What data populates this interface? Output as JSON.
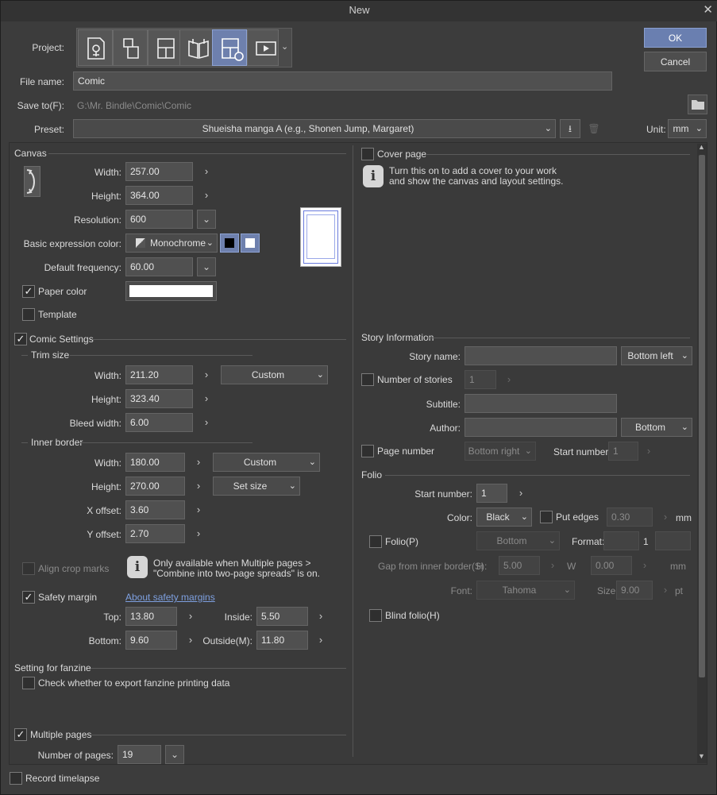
{
  "window": {
    "title": "New",
    "close_icon": "close-icon"
  },
  "buttons": {
    "ok": "OK",
    "cancel": "Cancel"
  },
  "project": {
    "label": "Project:",
    "items": [
      "illustration-icon",
      "webtoon-icon",
      "comic-icon",
      "book-icon",
      "comic-settings-icon",
      "animation-icon"
    ],
    "active_index": 4
  },
  "file_name": {
    "label": "File name:",
    "value": "Comic"
  },
  "save_to": {
    "label": "Save to(F):",
    "value": "G:\\Mr. Bindle\\Comic\\Comic"
  },
  "preset": {
    "label": "Preset:",
    "value": "Shueisha manga A (e.g., Shonen Jump, Margaret)",
    "unit_label": "Unit:",
    "unit_value": "mm"
  },
  "canvas": {
    "title": "Canvas",
    "width_label": "Width:",
    "width": "257.00",
    "height_label": "Height:",
    "height": "364.00",
    "resolution_label": "Resolution:",
    "resolution": "600",
    "color_label": "Basic expression color:",
    "color_value": "Monochrome",
    "freq_label": "Default frequency:",
    "freq": "60.00",
    "paper_color_label": "Paper color",
    "template_label": "Template"
  },
  "comic": {
    "title": "Comic Settings",
    "trim_title": "Trim size",
    "trim_width": "211.20",
    "trim_height": "323.40",
    "trim_preset": "Custom",
    "bleed_label": "Bleed width:",
    "bleed": "6.00",
    "inner_title": "Inner border",
    "inner_width": "180.00",
    "inner_height": "270.00",
    "inner_preset": "Custom",
    "inner_size": "Set size",
    "xoff_label": "X offset:",
    "xoff": "3.60",
    "yoff_label": "Y offset:",
    "yoff": "2.70",
    "width_label": "Width:",
    "height_label": "Height:",
    "align_label": "Align crop marks",
    "align_note_1": "Only available when Multiple pages >",
    "align_note_2": "\"Combine into two-page spreads\" is on.",
    "safety_label": "Safety margin",
    "safety_link": "About safety margins",
    "top_label": "Top:",
    "top": "13.80",
    "bottom_label": "Bottom:",
    "bottom": "9.60",
    "inside_label": "Inside:",
    "inside": "5.50",
    "outside_label": "Outside(M):",
    "outside": "11.80"
  },
  "fanzine": {
    "title": "Setting for fanzine",
    "check_label": "Check whether to export fanzine printing data"
  },
  "multiple": {
    "label": "Multiple pages",
    "pages_label": "Number of pages:",
    "pages": "19"
  },
  "timelapse": {
    "label": "Record timelapse"
  },
  "cover": {
    "label": "Cover page",
    "note_1": "Turn this on to add a cover to your work",
    "note_2": "and show the canvas and layout settings."
  },
  "story": {
    "title": "Story Information",
    "name_label": "Story name:",
    "name_pos": "Bottom left",
    "num_label": "Number of stories",
    "num": "1",
    "subtitle_label": "Subtitle:",
    "author_label": "Author:",
    "author_pos": "Bottom",
    "page_num_label": "Page number",
    "page_num_pos": "Bottom right",
    "start_label": "Start number:",
    "start": "1"
  },
  "folio": {
    "title": "Folio",
    "start_label": "Start number:",
    "start": "1",
    "color_label": "Color:",
    "color": "Black",
    "edges_label": "Put edges",
    "edges": "0.30",
    "mm": "mm",
    "folio_label": "Folio(P)",
    "folio_pos": "Bottom",
    "format_label": "Format:",
    "format": "1",
    "gap_label": "Gap from inner border(S):",
    "h_label": "H",
    "h": "5.00",
    "w_label": "W",
    "w": "0.00",
    "font_label": "Font:",
    "font": "Tahoma",
    "size_label": "Size:",
    "size": "9.00",
    "pt": "pt",
    "blind_label": "Blind folio(H)"
  }
}
